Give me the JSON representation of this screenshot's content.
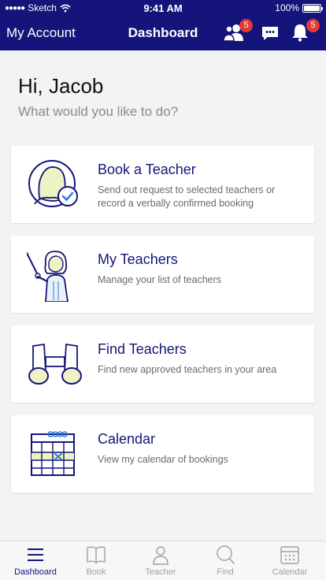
{
  "status_bar": {
    "carrier": "Sketch",
    "time": "9:41 AM",
    "battery": "100%"
  },
  "nav": {
    "left_label": "My Account",
    "title": "Dashboard",
    "contacts_badge": "5",
    "notifications_badge": "5"
  },
  "greeting": {
    "hello": "Hi, Jacob",
    "question": "What would you like to do?"
  },
  "cards": [
    {
      "title": "Book a Teacher",
      "description": "Send out request to selected teachers or record a verbally confirmed booking"
    },
    {
      "title": "My Teachers",
      "description": "Manage your list of teachers"
    },
    {
      "title": "Find Teachers",
      "description": "Find new approved teachers in your area"
    },
    {
      "title": "Calendar",
      "description": "View my calendar of bookings"
    }
  ],
  "tabs": [
    {
      "label": "Dashboard",
      "icon": "menu-icon",
      "active": true
    },
    {
      "label": "Book",
      "icon": "book-icon",
      "active": false
    },
    {
      "label": "Teacher",
      "icon": "person-icon",
      "active": false
    },
    {
      "label": "Find",
      "icon": "search-icon",
      "active": false
    },
    {
      "label": "Calendar",
      "icon": "calendar-icon",
      "active": false
    }
  ],
  "colors": {
    "primary": "#14147a",
    "accent": "#2b7fd6",
    "badge": "#e53935",
    "highlight": "#eef3c4"
  }
}
